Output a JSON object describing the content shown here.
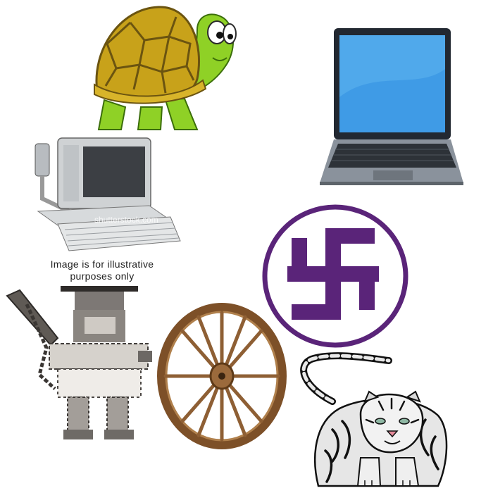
{
  "caption": {
    "line1": "Image is for illustrative",
    "line2": "purposes only"
  },
  "watermark": "shutterstock.com",
  "items": [
    {
      "icon": "turtle-icon"
    },
    {
      "icon": "laptop-icon"
    },
    {
      "icon": "desktop-computer-icon"
    },
    {
      "icon": "swastika-symbol-icon"
    },
    {
      "icon": "robot-figure-icon"
    },
    {
      "icon": "wagon-wheel-icon"
    },
    {
      "icon": "tiger-icon"
    }
  ],
  "colors": {
    "turtle_shell": "#c8a21a",
    "turtle_body": "#8fd126",
    "laptop_screen": "#3f9be6",
    "symbol_purple": "#5a2479",
    "wheel_wood": "#9b6a3c"
  }
}
